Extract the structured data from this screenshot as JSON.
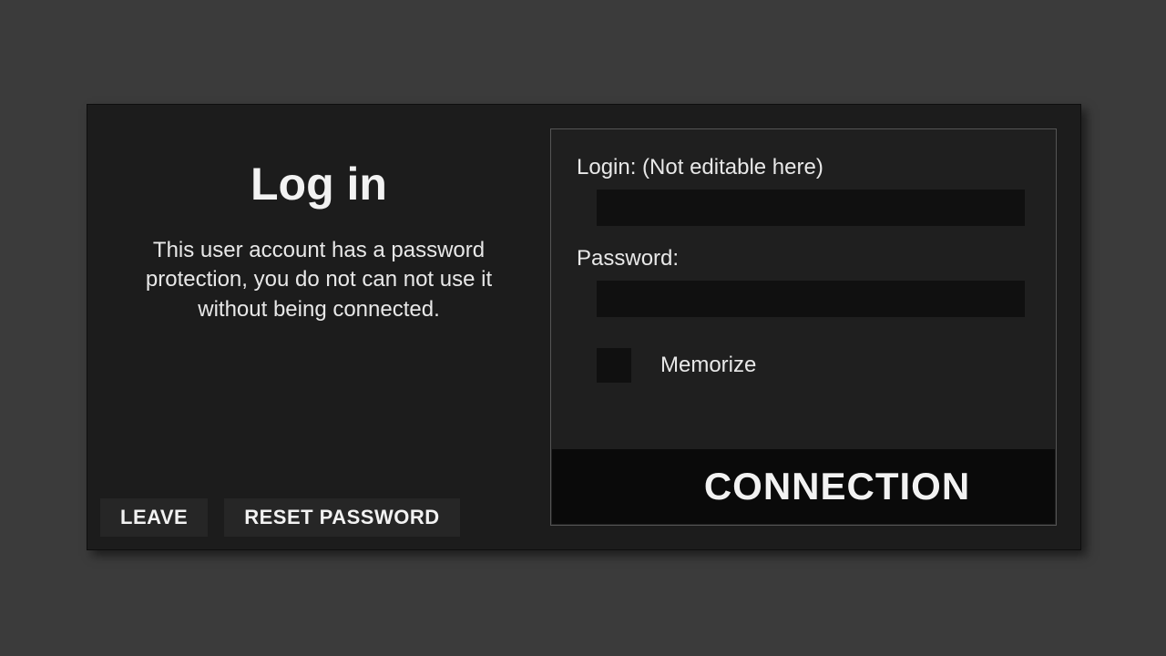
{
  "dialog": {
    "title": "Log in",
    "description": "This user account has a password protection, you do not can not use it without being connected."
  },
  "buttons": {
    "leave": "LEAVE",
    "reset_password": "RESET PASSWORD",
    "connection": "CONNECTION"
  },
  "form": {
    "login_label": "Login: (Not editable here)",
    "login_value": "",
    "password_label": "Password:",
    "password_value": "",
    "memorize_label": "Memorize",
    "memorize_checked": false
  }
}
